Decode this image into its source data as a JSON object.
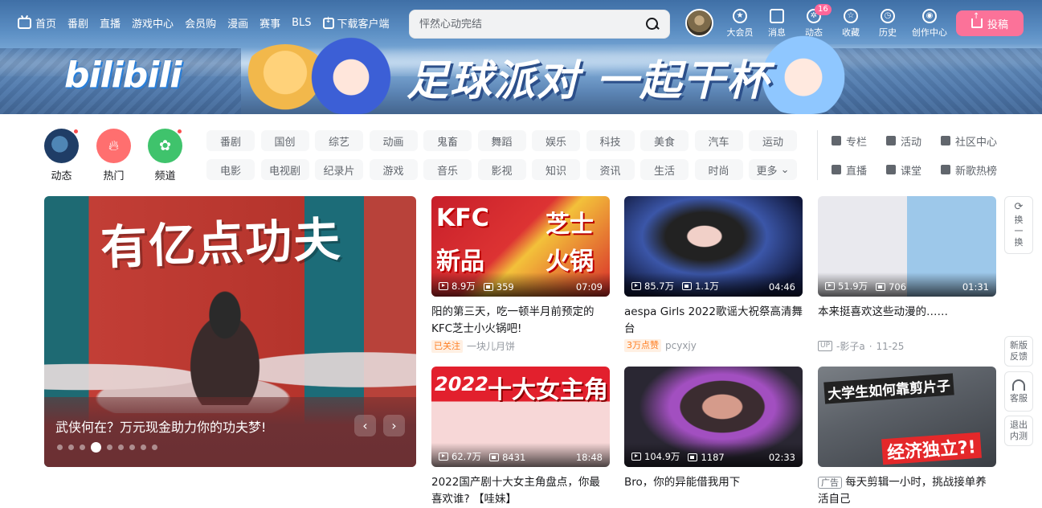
{
  "nav": {
    "home": "首页",
    "items": [
      "番剧",
      "直播",
      "游戏中心",
      "会员购",
      "漫画",
      "赛事",
      "BLS"
    ],
    "download": "下载客户端",
    "search_placeholder": "怦然心动完结",
    "right": [
      {
        "label": "大会员",
        "icon": "vip-icon"
      },
      {
        "label": "消息",
        "icon": "message-icon"
      },
      {
        "label": "动态",
        "icon": "dynamic-icon",
        "badge": "16"
      },
      {
        "label": "收藏",
        "icon": "star-icon"
      },
      {
        "label": "历史",
        "icon": "clock-icon"
      },
      {
        "label": "创作中心",
        "icon": "bulb-icon"
      }
    ],
    "upload": "投稿"
  },
  "banner": {
    "logo": "bilibili",
    "slogan": "足球派对 一起干杯"
  },
  "quick": [
    {
      "label": "动态",
      "icon": "dynamic-avatar"
    },
    {
      "label": "热门",
      "icon": "fire-icon"
    },
    {
      "label": "频道",
      "icon": "channel-icon"
    }
  ],
  "channels": [
    "番剧",
    "国创",
    "综艺",
    "动画",
    "鬼畜",
    "舞蹈",
    "娱乐",
    "科技",
    "美食",
    "汽车",
    "运动",
    "电影",
    "电视剧",
    "纪录片",
    "游戏",
    "音乐",
    "影视",
    "知识",
    "资讯",
    "生活",
    "时尚",
    "更多"
  ],
  "links": [
    {
      "label": "专栏",
      "icon": "column-icon"
    },
    {
      "label": "活动",
      "icon": "flag-icon"
    },
    {
      "label": "社区中心",
      "icon": "community-icon"
    },
    {
      "label": "直播",
      "icon": "live-icon"
    },
    {
      "label": "课堂",
      "icon": "class-icon"
    },
    {
      "label": "新歌热榜",
      "icon": "music-icon"
    }
  ],
  "carousel": {
    "art_title": "有亿点功夫",
    "caption": "武侠何在？万元现金助力你的功夫梦!",
    "slides": 9,
    "active": 3
  },
  "cards": [
    {
      "thumb_text": [
        "KFC",
        "芝士",
        "新品",
        "火锅"
      ],
      "plays": "8.9万",
      "danmaku": "359",
      "duration": "07:09",
      "title": "阳的第三天，吃一顿半月前预定的KFC芝士小火锅吧!",
      "tag": "已关注",
      "author": "一块儿月饼",
      "date": ""
    },
    {
      "thumb_text": [],
      "plays": "85.7万",
      "danmaku": "1.1万",
      "duration": "04:46",
      "title": "aespa Girls 2022歌谣大祝祭高清舞台",
      "tag": "3万点赞",
      "author": "pcyxjy",
      "date": ""
    },
    {
      "thumb_text": [],
      "plays": "51.9万",
      "danmaku": "706",
      "duration": "01:31",
      "title": "本来挺喜欢这些动漫的……",
      "tag": "UP",
      "author": "-影子a",
      "date": "11-25"
    },
    {
      "thumb_text": [
        "2022",
        "十大女主角"
      ],
      "plays": "62.7万",
      "danmaku": "8431",
      "duration": "18:48",
      "title": "2022国产剧十大女主角盘点，你最喜欢谁? 【哇妹】",
      "tag": "",
      "author": "",
      "date": ""
    },
    {
      "thumb_text": [],
      "plays": "104.9万",
      "danmaku": "1187",
      "duration": "02:33",
      "title": "Bro，你的异能借我用下",
      "tag": "",
      "author": "",
      "date": ""
    },
    {
      "thumb_text": [
        "大学生如何靠剪片子",
        "经济独立?!"
      ],
      "plays": "",
      "danmaku": "",
      "duration": "",
      "title": "每天剪辑一小时，挑战接单养活自己",
      "tag": "广告",
      "author": "",
      "date": ""
    }
  ],
  "rail": {
    "refresh": "换一换",
    "feedback": "新版反馈",
    "service": "客服",
    "exit": "退出内测"
  }
}
